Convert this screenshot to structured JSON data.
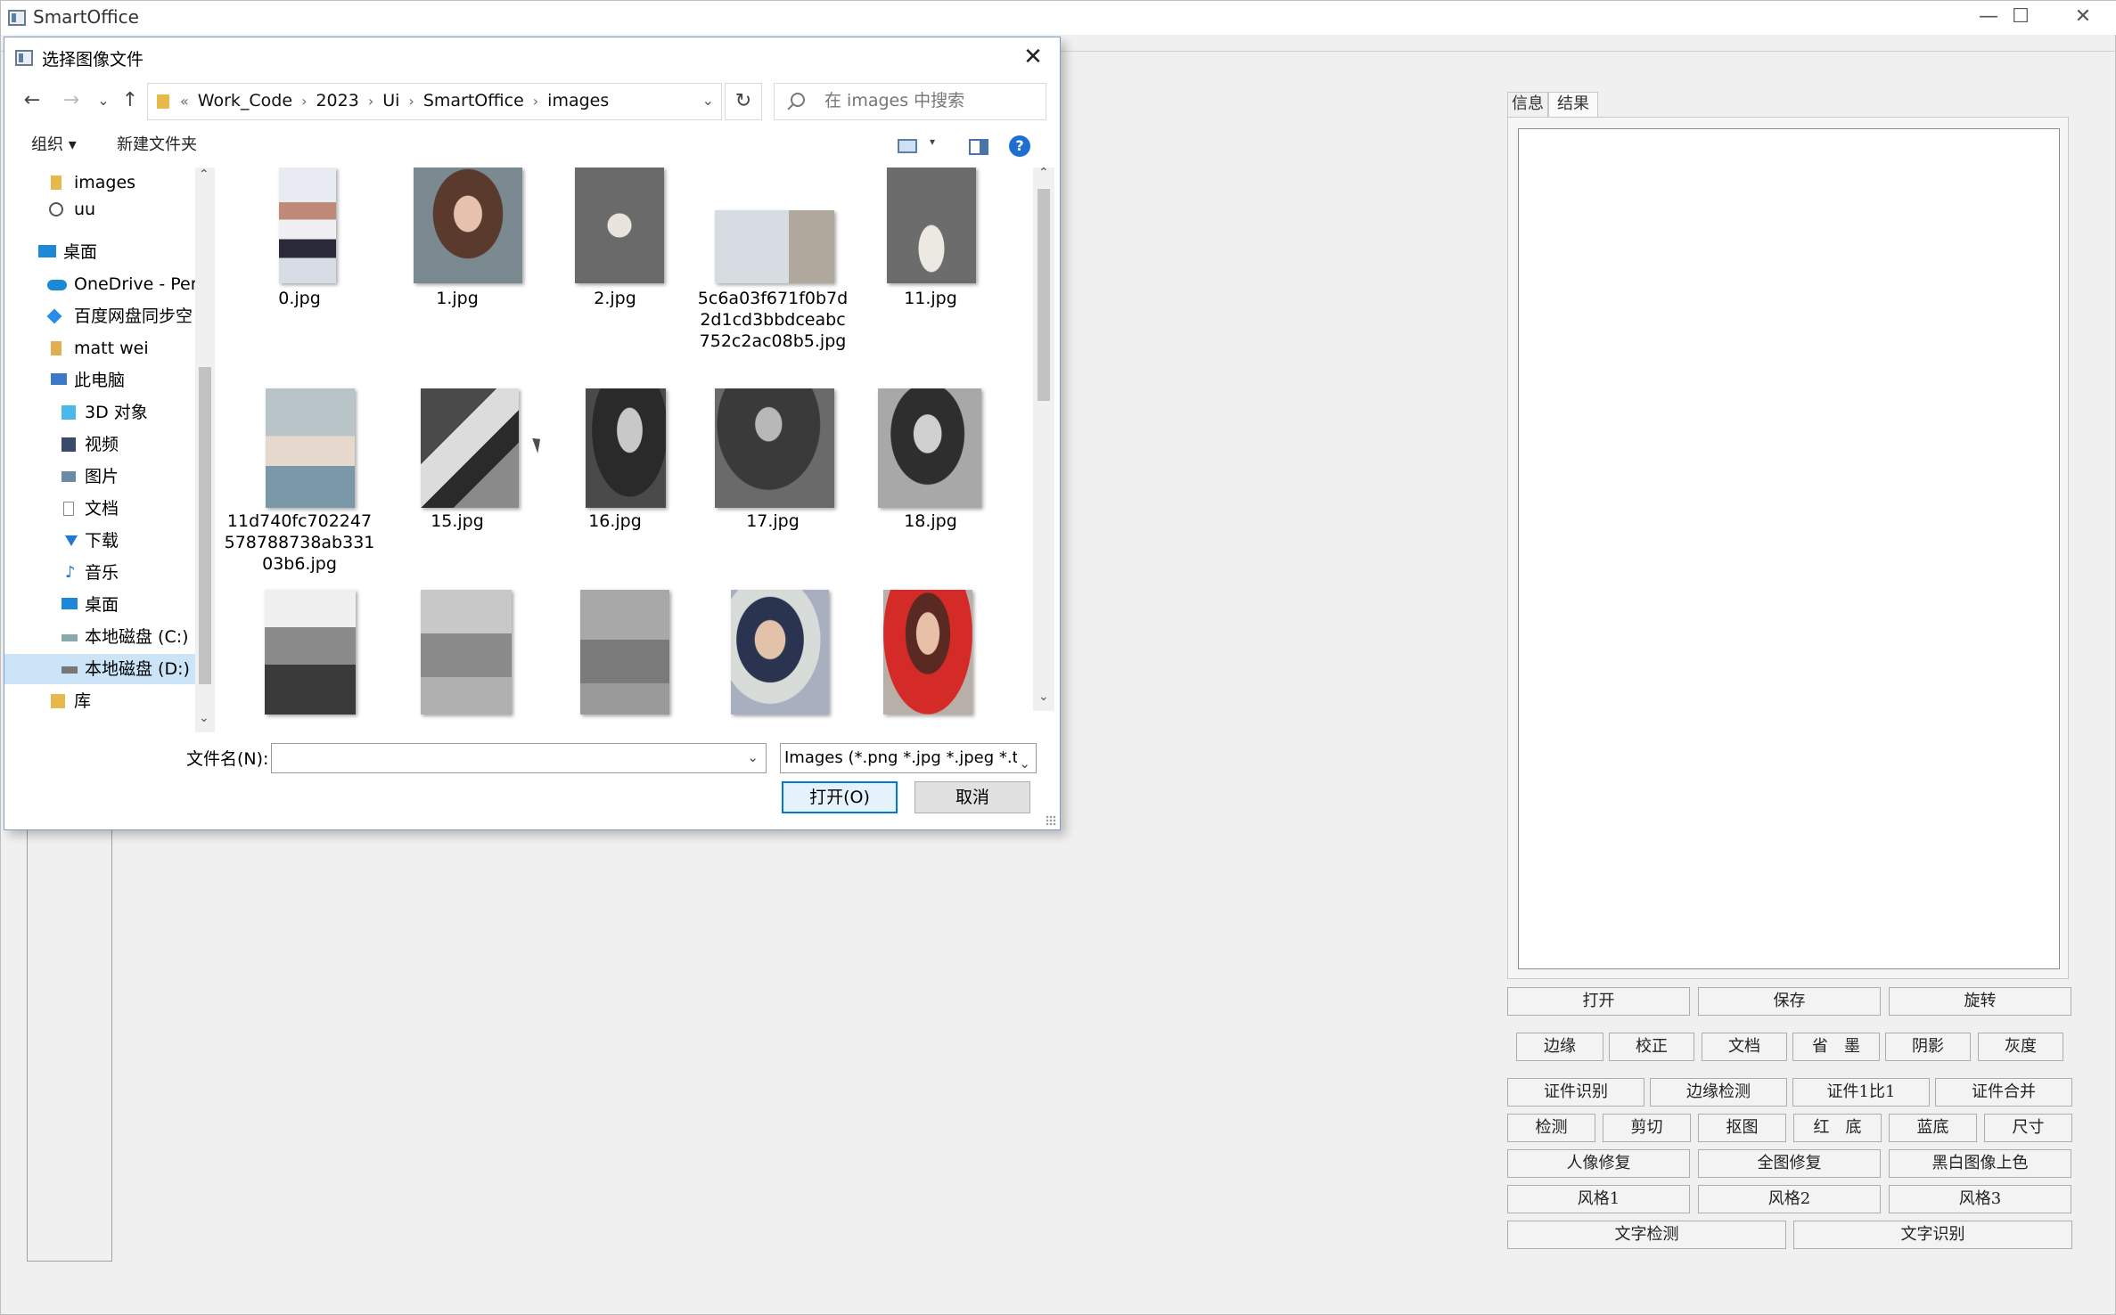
{
  "main_window": {
    "title": "SmartOffice",
    "minimize": "—",
    "maximize": "☐",
    "close": "✕",
    "tabs": [
      {
        "label": "信息"
      },
      {
        "label": "结果"
      }
    ],
    "buttons": {
      "row1": [
        "打开",
        "保存",
        "旋转"
      ],
      "row2": [
        "边缘",
        "校正",
        "文档",
        "省　墨",
        "阴影",
        "灰度"
      ],
      "row3": [
        "证件识别",
        "边缘检测",
        "证件1比1",
        "证件合并"
      ],
      "row4": [
        "检测",
        "剪切",
        "抠图",
        "红　底",
        "蓝底",
        "尺寸"
      ],
      "row5": [
        "人像修复",
        "全图修复",
        "黑白图像上色"
      ],
      "row6": [
        "风格1",
        "风格2",
        "风格3"
      ],
      "row7": [
        "文字检测",
        "文字识别"
      ]
    }
  },
  "dialog": {
    "title": "选择图像文件",
    "close": "✕",
    "nav": {
      "back": "←",
      "forward": "→",
      "history": "⌄",
      "up": "↑"
    },
    "breadcrumb": {
      "overflow": "«",
      "items": [
        "Work_Code",
        "2023",
        "Ui",
        "SmartOffice",
        "images"
      ],
      "sep": "›"
    },
    "refresh": "↻",
    "search_placeholder": "在 images 中搜索",
    "toolbar": {
      "organize": "组织 ▾",
      "new_folder": "新建文件夹",
      "view_dropdown": "▾",
      "help": "?"
    },
    "nav_pane": [
      {
        "label": "images",
        "icon": "folder-icon"
      },
      {
        "label": "uu",
        "icon": "user-folder-icon"
      },
      {
        "label": "桌面",
        "icon": "desktop-icon"
      },
      {
        "label": "OneDrive - Pers",
        "icon": "cloud-icon"
      },
      {
        "label": "百度网盘同步空",
        "icon": "baidu-icon"
      },
      {
        "label": "matt wei",
        "icon": "user-icon"
      },
      {
        "label": "此电脑",
        "icon": "computer-icon"
      },
      {
        "label": "3D 对象",
        "icon": "cube-icon"
      },
      {
        "label": "视频",
        "icon": "video-icon"
      },
      {
        "label": "图片",
        "icon": "picture-icon"
      },
      {
        "label": "文档",
        "icon": "document-icon"
      },
      {
        "label": "下载",
        "icon": "download-icon"
      },
      {
        "label": "音乐",
        "icon": "music-icon"
      },
      {
        "label": "桌面",
        "icon": "desktop-icon"
      },
      {
        "label": "本地磁盘 (C:)",
        "icon": "drive-c-icon"
      },
      {
        "label": "本地磁盘 (D:)",
        "icon": "drive-d-icon"
      },
      {
        "label": "库",
        "icon": "library-icon"
      }
    ],
    "files": [
      {
        "name": "0.jpg"
      },
      {
        "name": "1.jpg"
      },
      {
        "name": "2.jpg"
      },
      {
        "name": "5c6a03f671f0b7d2d1cd3bbdceabc752c2ac08b5.jpg"
      },
      {
        "name": "11.jpg"
      },
      {
        "name": "11d740fc702247578788738ab33103b6.jpg"
      },
      {
        "name": "15.jpg"
      },
      {
        "name": "16.jpg"
      },
      {
        "name": "17.jpg"
      },
      {
        "name": "18.jpg"
      },
      {
        "name": ""
      },
      {
        "name": ""
      },
      {
        "name": ""
      },
      {
        "name": ""
      },
      {
        "name": ""
      }
    ],
    "filename_label": "文件名(N):",
    "filename_value": "",
    "filter_value": "Images (*.png *.jpg *.jpeg *.ti",
    "open_button": "打开(O)",
    "cancel_button": "取消"
  }
}
